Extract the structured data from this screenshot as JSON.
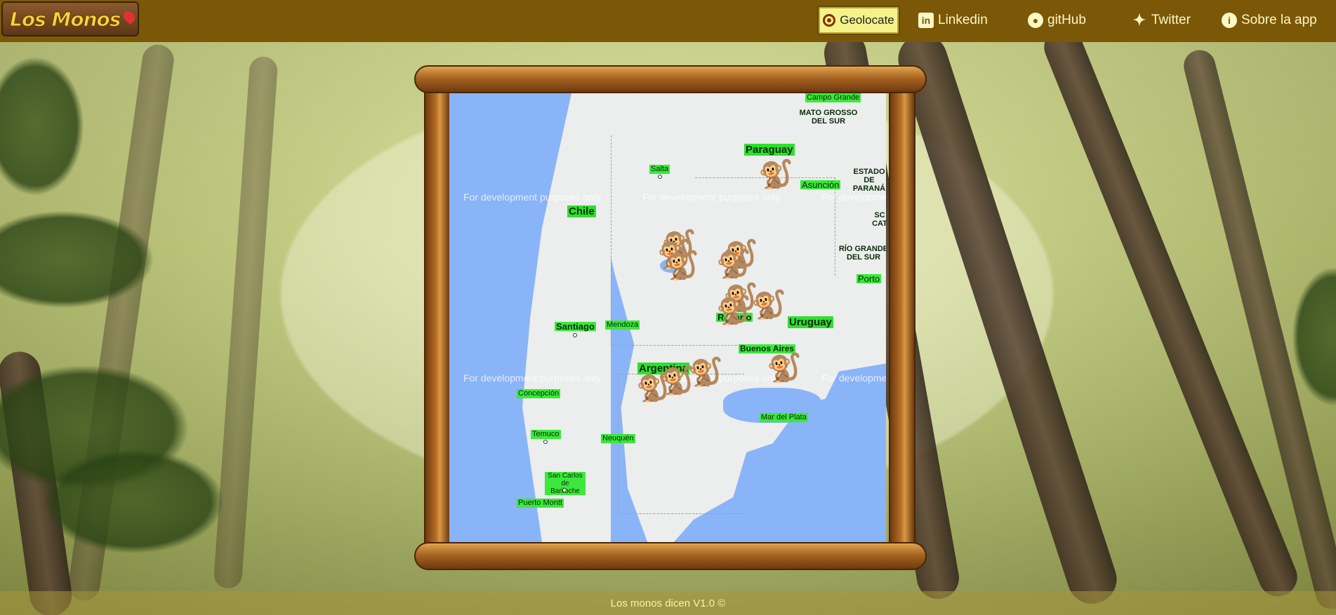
{
  "header": {
    "logo_text": "Los Monos",
    "geolocate_label": "Geolocate",
    "links": [
      {
        "label": "Linkedin",
        "icon": "linkedin-icon"
      },
      {
        "label": "gitHub",
        "icon": "github-icon"
      },
      {
        "label": "Twitter",
        "icon": "twitter-icon"
      },
      {
        "label": "Sobre la app",
        "icon": "info-icon"
      }
    ]
  },
  "map": {
    "watermark": "For development purposes only",
    "labels": {
      "campo_grande": "Campo Grande",
      "mato_grosso": "MATO GROSSO DEL SUR",
      "paraguay": "Paraguay",
      "asuncion": "Asunción",
      "estado_parana": "ESTADO DE PARANÁ",
      "salta": "Salta",
      "chile": "Chile",
      "sc": "SC CAT",
      "rio_grande": "RÍO GRANDE DEL SUR",
      "porto": "Porto",
      "rosario": "Rosario",
      "uruguay": "Uruguay",
      "santiago": "Santiago",
      "mendoza": "Mendoza",
      "buenos_aires": "Buenos Aires",
      "argentina": "Argentina",
      "concepcion": "Concepción",
      "mar_del_plata": "Mar del Plata",
      "temuco": "Temuco",
      "neuquen": "Neuquén",
      "bariloche": "San Carlos de Bariloche",
      "puerto_montt": "Puerto Montt"
    },
    "monkey_marker": "🐒"
  },
  "footer": {
    "text": "Los monos dicen V1.0 ©"
  }
}
